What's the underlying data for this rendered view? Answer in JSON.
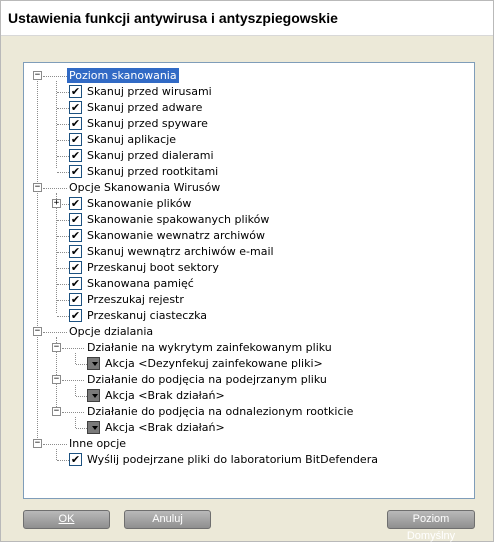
{
  "window": {
    "title": "Ustawienia funkcji antywirusa i antyszpiegowskie"
  },
  "tree": {
    "groups": [
      {
        "label": "Poziom skanowania",
        "expander": "−",
        "items": [
          {
            "label": "Skanuj przed wirusami",
            "checked": true
          },
          {
            "label": "Skanuj przed adware",
            "checked": true
          },
          {
            "label": "Skanuj przed spyware",
            "checked": true
          },
          {
            "label": "Skanuj aplikacje",
            "checked": true
          },
          {
            "label": "Skanuj przed dialerami",
            "checked": true
          },
          {
            "label": "Skanuj przed rootkitami",
            "checked": true
          }
        ]
      },
      {
        "label": "Opcje Skanowania Wirusów",
        "expander": "−",
        "items": [
          {
            "label": "Skanowanie plików",
            "checked": true,
            "expander": "+"
          },
          {
            "label": "Skanowanie spakowanych plików",
            "checked": true
          },
          {
            "label": "Skanowanie wewnatrz archiwów",
            "checked": true
          },
          {
            "label": "Skanuj wewnątrz archiwów e-mail",
            "checked": true
          },
          {
            "label": "Przeskanuj boot sektory",
            "checked": true
          },
          {
            "label": "Skanowana pamięć",
            "checked": true
          },
          {
            "label": "Przeszukaj rejestr",
            "checked": true
          },
          {
            "label": "Przeskanuj ciasteczka",
            "checked": true
          }
        ]
      },
      {
        "label": "Opcje dzialania",
        "expander": "−",
        "subgroups": [
          {
            "label": "Działanie na wykrytym zainfekowanym pliku",
            "expander": "−",
            "action": "Akcja <Dezynfekuj zainfekowane pliki>"
          },
          {
            "label": "Działanie do podjęcia na podejrzanym pliku",
            "expander": "−",
            "action": "Akcja <Brak działań>"
          },
          {
            "label": "Działanie do podjęcia na odnalezionym rootkicie",
            "expander": "−",
            "action": "Akcja <Brak działań>"
          }
        ]
      },
      {
        "label": "Inne opcje",
        "expander": "−",
        "items": [
          {
            "label": "Wyślij podejrzane pliki do laboratorium BitDefendera",
            "checked": true
          }
        ]
      }
    ]
  },
  "buttons": {
    "ok_label": "OK",
    "cancel_label": "Anuluj",
    "default_label": "Poziom Domyślny"
  },
  "colors": {
    "selection": "#316ac5",
    "button_face": "#a6a6a6",
    "panel_border": "#7f9db9"
  },
  "check_glyph": "✔"
}
